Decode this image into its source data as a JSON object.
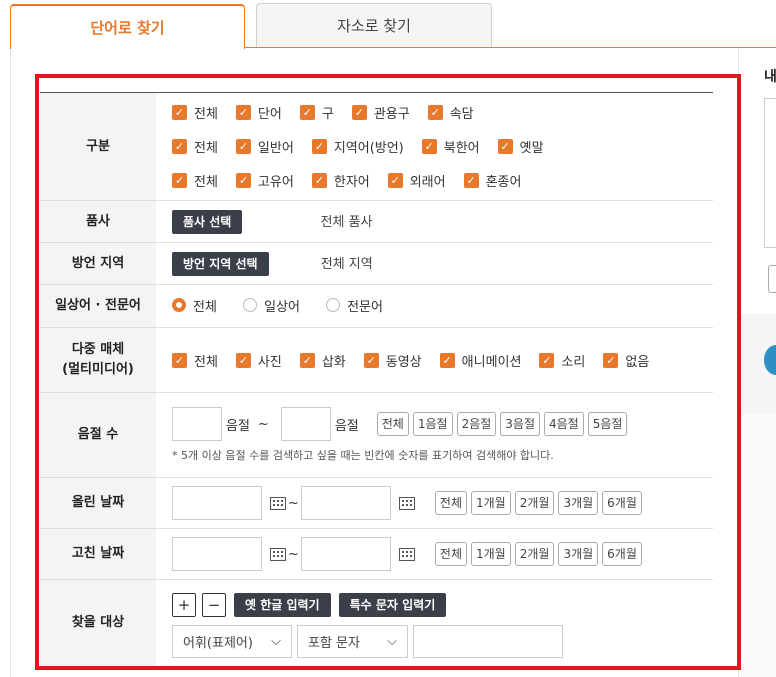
{
  "tabs": [
    {
      "label": "단어로 찾기"
    },
    {
      "label": "자소로 찾기"
    }
  ],
  "side": {
    "title": "내"
  },
  "form": {
    "gubun": {
      "label": "구분",
      "rows": [
        [
          "전체",
          "단어",
          "구",
          "관용구",
          "속담"
        ],
        [
          "전체",
          "일반어",
          "지역어(방언)",
          "북한어",
          "옛말"
        ],
        [
          "전체",
          "고유어",
          "한자어",
          "외래어",
          "혼종어"
        ]
      ]
    },
    "pumsa": {
      "label": "품사",
      "button": "품사 선택",
      "value": "전체 품사"
    },
    "dialect": {
      "label": "방언 지역",
      "button": "방언 지역 선택",
      "value": "전체 지역"
    },
    "usage": {
      "label": "일상어 · 전문어",
      "options": [
        "전체",
        "일상어",
        "전문어"
      ],
      "selected": 0
    },
    "media": {
      "label_line1": "다중 매체",
      "label_line2": "(멀티미디어)",
      "options": [
        "전체",
        "사진",
        "삽화",
        "동영상",
        "애니메이션",
        "소리",
        "없음"
      ]
    },
    "syllable": {
      "label": "음절 수",
      "unit": "음절",
      "tilde": "~",
      "buttons": [
        "전체",
        "1음절",
        "2음절",
        "3음절",
        "4음절",
        "5음절"
      ],
      "note": "* 5개 이상 음절 수를 검색하고 싶을 때는 빈칸에 숫자를 표기하여 검색해야 합니다."
    },
    "posted": {
      "label": "올린 날짜",
      "tilde": "~",
      "buttons": [
        "전체",
        "1개월",
        "2개월",
        "3개월",
        "6개월"
      ]
    },
    "modified": {
      "label": "고친 날짜",
      "tilde": "~",
      "buttons": [
        "전체",
        "1개월",
        "2개월",
        "3개월",
        "6개월"
      ]
    },
    "target": {
      "label": "찾을 대상",
      "plus": "+",
      "minus": "−",
      "old_hangul": "옛 한글 입력기",
      "special": "특수 문자 입력기",
      "select1": "어휘(표제어)",
      "select2": "포함 문자"
    }
  },
  "colors": {
    "accent": "#e8782a",
    "frame": "#e6141e",
    "dark_button": "#3a3f4a"
  }
}
